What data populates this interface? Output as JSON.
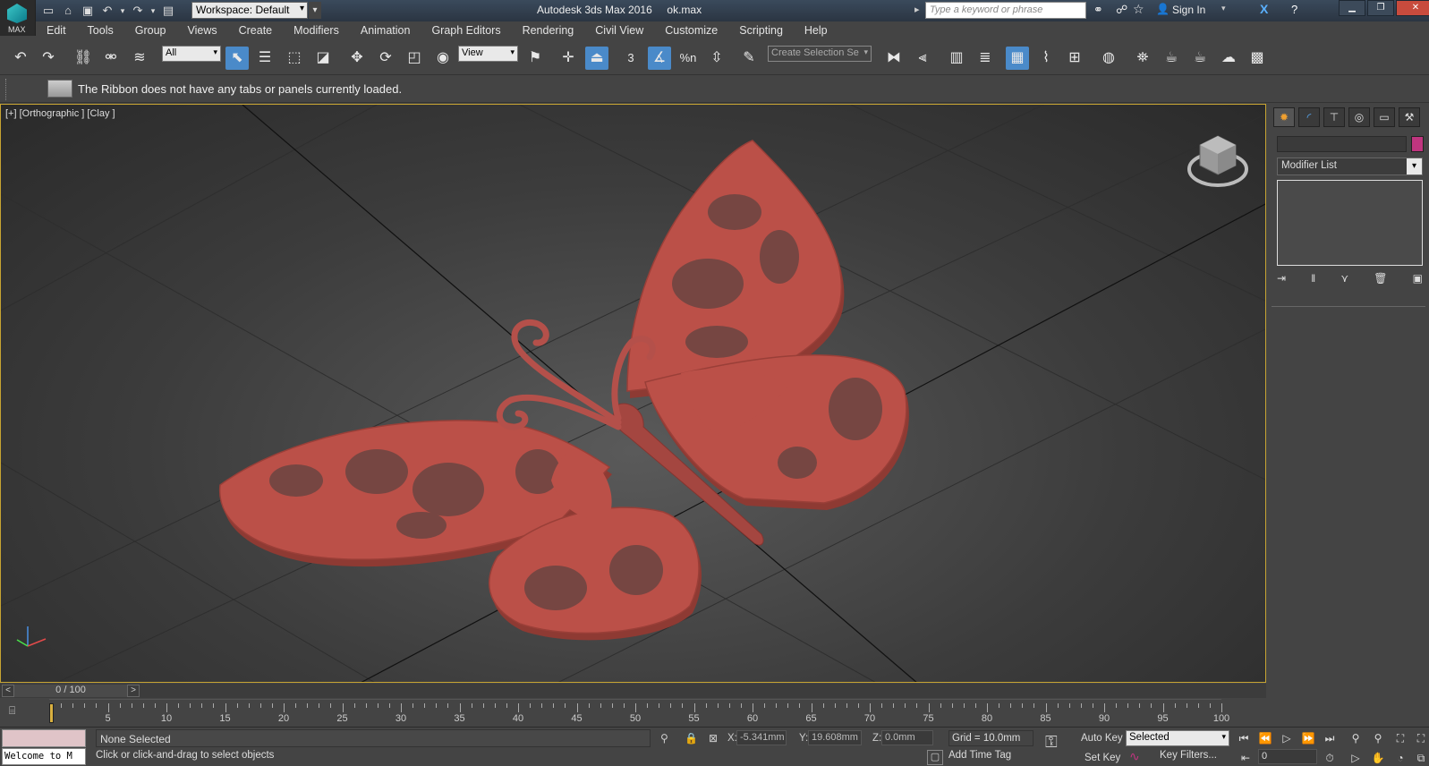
{
  "app": {
    "logo_text": "MAX",
    "title": "Autodesk 3ds Max 2016",
    "filename": "ok.max",
    "workspace": "Workspace: Default",
    "search_placeholder": "Type a keyword or phrase",
    "sign_in": "Sign In"
  },
  "menu": [
    "Edit",
    "Tools",
    "Group",
    "Views",
    "Create",
    "Modifiers",
    "Animation",
    "Graph Editors",
    "Rendering",
    "Civil View",
    "Customize",
    "Scripting",
    "Help"
  ],
  "toolbar": {
    "selection_filter": "All",
    "ref_coord": "View",
    "named_selection_placeholder": "Create Selection Se",
    "snap_label": "3",
    "percent_snap": "%n"
  },
  "ribbon": {
    "message": "The Ribbon does not have any tabs or panels currently loaded."
  },
  "viewport": {
    "label": "[+] [Orthographic ] [Clay ]",
    "object_color": "#b4504a"
  },
  "command_panel": {
    "modifier_list": "Modifier List",
    "object_color": "#c0357f"
  },
  "timeline": {
    "slider_label": "0 / 100",
    "ticks": [
      5,
      10,
      15,
      20,
      25,
      30,
      35,
      40,
      45,
      50,
      55,
      60,
      65,
      70,
      75,
      80,
      85,
      90,
      95,
      100
    ]
  },
  "status": {
    "listener_text": "Welcome to M",
    "selection": "None Selected",
    "prompt": "Click or click-and-drag to select objects",
    "x_label": "X:",
    "x_value": "-5.341mm",
    "y_label": "Y:",
    "y_value": "19.608mm",
    "z_label": "Z:",
    "z_value": "0.0mm",
    "grid": "Grid = 10.0mm",
    "add_time_tag": "Add Time Tag",
    "auto_key": "Auto Key",
    "set_key": "Set Key",
    "key_mode": "Selected",
    "key_filters": "Key Filters...",
    "frame": "0"
  }
}
